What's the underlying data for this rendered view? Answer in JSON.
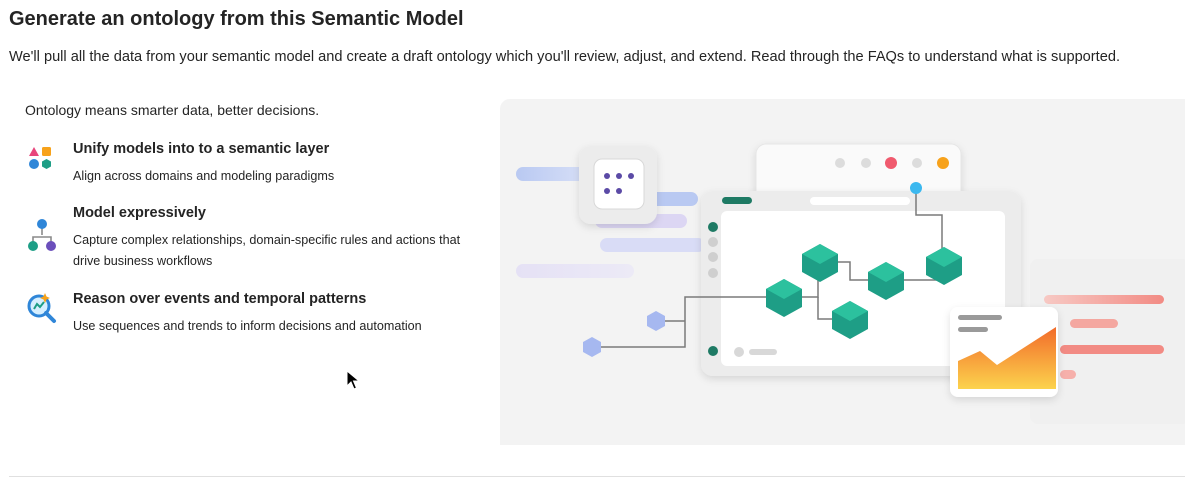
{
  "header": {
    "title": "Generate an ontology from this Semantic Model",
    "description": "We'll pull all the data from your semantic model and create a draft ontology which you'll review, adjust, and extend. Read through the FAQs to understand what is supported."
  },
  "intro": "Ontology means smarter data, better decisions.",
  "features": [
    {
      "title": "Unify models into to a semantic layer",
      "description": "Align across domains and modeling paradigms",
      "icon": "shapes-icon"
    },
    {
      "title": "Model expressively",
      "description": "Capture complex relationships, domain-specific rules and actions that drive business workflows",
      "icon": "hierarchy-icon"
    },
    {
      "title": "Reason over events and temporal patterns",
      "description": "Use sequences and trends to inform decisions and automation",
      "icon": "search-sparkle-icon"
    }
  ],
  "colors": {
    "accent_teal": "#1e9e86",
    "accent_purple": "#6b4fbb",
    "accent_blue": "#3b8fd9",
    "accent_orange": "#f7a21b",
    "accent_red": "#f05a6e"
  }
}
